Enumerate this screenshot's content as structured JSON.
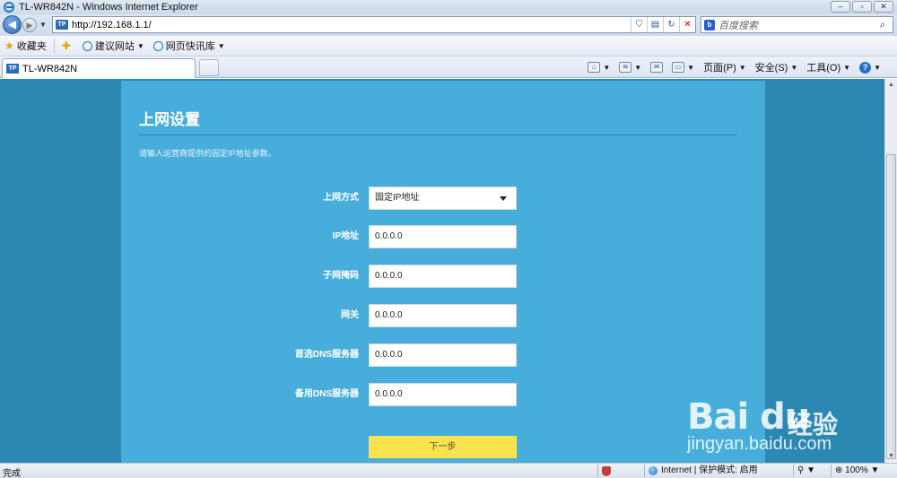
{
  "browser": {
    "window_title": "TL-WR842N - Windows Internet Explorer",
    "url": "http://192.168.1.1/",
    "search_placeholder": "百度搜索",
    "tab_title": "TL-WR842N",
    "site_icon_label": "TP",
    "favorites": {
      "label": "收藏夹",
      "items": [
        {
          "label": "建议网站"
        },
        {
          "label": "网页快讯库"
        }
      ]
    },
    "commands": {
      "page": "页面(P)",
      "safety": "安全(S)",
      "tools": "工具(O)"
    },
    "status": {
      "text": "完成",
      "zone": "Internet | 保护模式: 启用",
      "zoom": "100%"
    }
  },
  "page": {
    "title": "上网设置",
    "hint": "请输入运营商提供的固定IP地址参数。",
    "fields": [
      {
        "label": "上网方式",
        "value": "固定IP地址",
        "type": "select"
      },
      {
        "label": "IP地址",
        "value": "0.0.0.0"
      },
      {
        "label": "子网掩码",
        "value": "0.0.0.0"
      },
      {
        "label": "网关",
        "value": "0.0.0.0"
      },
      {
        "label": "首选DNS服务器",
        "value": "0.0.0.0"
      },
      {
        "label": "备用DNS服务器",
        "value": "0.0.0.0"
      }
    ],
    "next_button": "下一步"
  },
  "watermark": {
    "logo": "Bai du",
    "cn": "经验",
    "url": "jingyan.baidu.com"
  },
  "colors": {
    "background": "#2a88b3",
    "panel": "#47aedb",
    "next_button": "#fbe34f"
  }
}
